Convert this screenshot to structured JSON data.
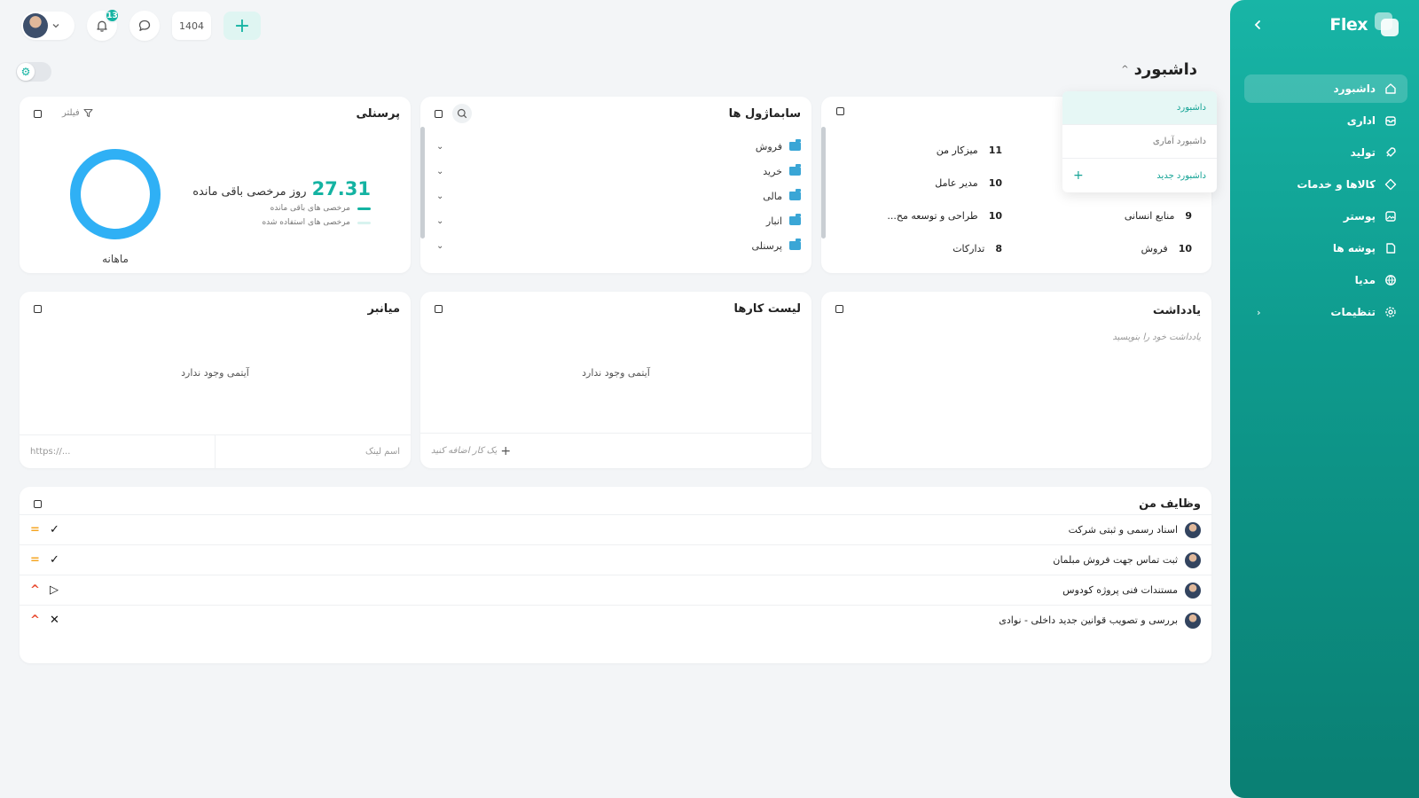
{
  "sidebar": {
    "brand": "Flex",
    "items": [
      {
        "label": "داشبورد",
        "icon": "home-icon",
        "active": true
      },
      {
        "label": "اداری",
        "icon": "inbox-icon"
      },
      {
        "label": "تولید",
        "icon": "rocket-icon"
      },
      {
        "label": "کالاها و خدمات",
        "icon": "diamond-icon"
      },
      {
        "label": "پوستر",
        "icon": "image-icon"
      },
      {
        "label": "پوشه ها",
        "icon": "folder-icon"
      },
      {
        "label": "مدیا",
        "icon": "globe-icon"
      },
      {
        "label": "تنظیمات",
        "icon": "gear-icon",
        "has_children": true
      }
    ]
  },
  "topbar": {
    "notifications_count": "13",
    "year": "1404"
  },
  "page": {
    "title": "داشبورد"
  },
  "dashboard_menu": {
    "items": [
      "داشبورد",
      "داشبورد آماری"
    ],
    "new_label": "داشبورد جدید"
  },
  "personnel": {
    "title": "پرسنلی",
    "filter_label": "فیلتر",
    "remaining_days": "27.31",
    "remaining_text": "روز مرخصی باقی مانده",
    "legend_remaining": "مرخصی های باقی مانده",
    "legend_used": "مرخصی های استفاده شده",
    "period": "ماهانه",
    "remaining_fraction": 1.0,
    "colors": {
      "remaining": "#2fb0f5",
      "used": "#d8f3ef"
    }
  },
  "subsystems": {
    "title": "سابماژول ها",
    "items": [
      "فروش",
      "خرید",
      "مالی",
      "انبار",
      "پرسنلی"
    ]
  },
  "workload": {
    "items": [
      {
        "count": "11",
        "label": "میزکار من"
      },
      {
        "count": "10",
        "label": "مدیر عامل"
      },
      {
        "count": "9",
        "label": "منابع انسانی"
      },
      {
        "count": "10",
        "label": "طراحی و توسعه مح..."
      },
      {
        "count": "10",
        "label": "فروش"
      },
      {
        "count": "8",
        "label": "تدارکات"
      }
    ]
  },
  "shortcuts": {
    "title": "میانبر",
    "empty": "آیتمی وجود ندارد",
    "name_placeholder": "اسم لینک",
    "url_placeholder": "https://..."
  },
  "todo": {
    "title": "لیست کارها",
    "empty": "آیتمی وجود ندارد",
    "add_placeholder": "یک کار اضافه کنید"
  },
  "note": {
    "title": "یادداشت",
    "placeholder": "یادداشت خود را بنویسید"
  },
  "tasks": {
    "title": "وظایف من",
    "items": [
      {
        "title": "اسناد رسمی و ثبتی شرکت",
        "status": "✓",
        "priority": "=",
        "priority_color": "#f5a623"
      },
      {
        "title": "ثبت تماس جهت فروش مبلمان",
        "status": "✓",
        "priority": "=",
        "priority_color": "#f5a623"
      },
      {
        "title": "مستندات فنی پروژه کودوس",
        "status": "▷",
        "priority": "^",
        "priority_color": "#e8492f"
      },
      {
        "title": "بررسی و تصویب قوانین جدید داخلی - نوادی",
        "status": "✕",
        "priority": "^",
        "priority_color": "#e8492f"
      }
    ]
  }
}
